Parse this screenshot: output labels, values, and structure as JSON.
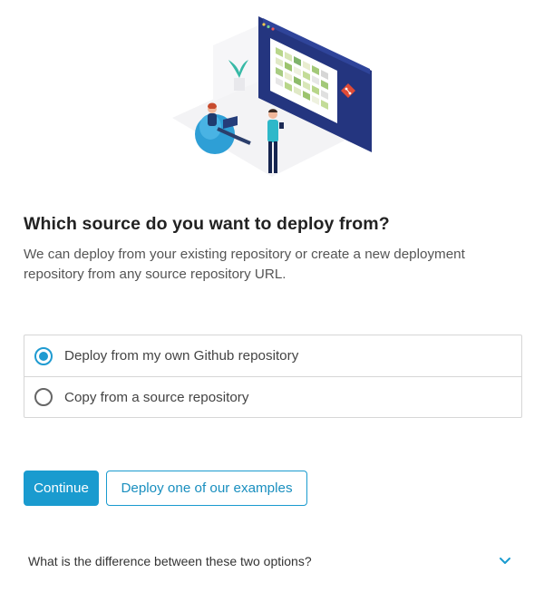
{
  "heading": "Which source do you want to deploy from?",
  "description": "We can deploy from your existing repository or create a new deployment repository from any source repository URL.",
  "options": [
    {
      "label": "Deploy from my own Github repository",
      "selected": true
    },
    {
      "label": "Copy from a source repository",
      "selected": false
    }
  ],
  "buttons": {
    "continue_label": "Continue",
    "examples_label": "Deploy one of our examples"
  },
  "faq": {
    "question": "What is the difference between these two options?",
    "icon": "chevron-down-icon"
  },
  "colors": {
    "accent": "#1a9bcf",
    "screen_panel": "#2a3f8f",
    "git_logo": "#e04b36"
  }
}
